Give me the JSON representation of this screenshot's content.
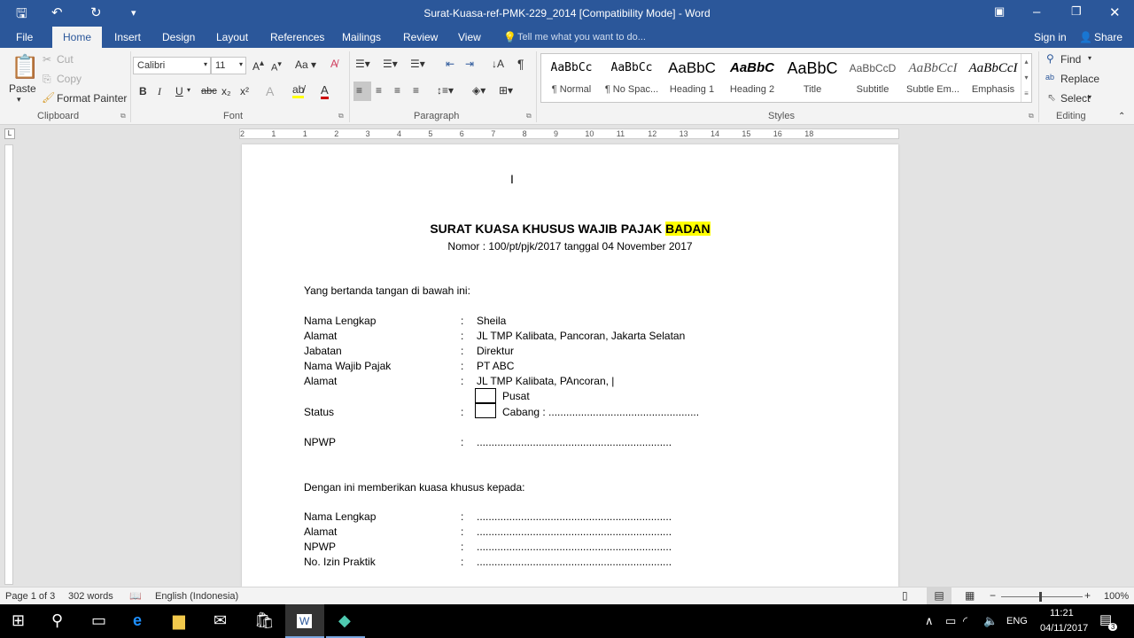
{
  "window": {
    "title": "Surat-Kuasa-ref-PMK-229_2014 [Compatibility Mode] - Word",
    "accent": "#2b579a"
  },
  "menu": {
    "tabs": [
      "File",
      "Home",
      "Insert",
      "Design",
      "Layout",
      "References",
      "Mailings",
      "Review",
      "View"
    ],
    "active": "Home",
    "tell_me": "Tell me what you want to do...",
    "sign_in": "Sign in",
    "share": "Share"
  },
  "ribbon": {
    "clipboard": {
      "label": "Clipboard",
      "paste": "Paste",
      "cut": "Cut",
      "copy": "Copy",
      "format_painter": "Format Painter"
    },
    "font": {
      "label": "Font",
      "name": "Calibri",
      "size": "11",
      "bold": "B",
      "italic": "I",
      "underline": "U",
      "strike": "abc",
      "sub": "x₂",
      "sup": "x²",
      "case": "Aa"
    },
    "paragraph": {
      "label": "Paragraph"
    },
    "styles": {
      "label": "Styles",
      "items": [
        {
          "preview": "AaBbCc",
          "name": "¶ Normal"
        },
        {
          "preview": "AaBbCc",
          "name": "¶ No Spac..."
        },
        {
          "preview": "AaBbC",
          "name": "Heading 1"
        },
        {
          "preview": "AaBbC",
          "name": "Heading 2"
        },
        {
          "preview": "AaBbC",
          "name": "Title"
        },
        {
          "preview": "AaBbCcD",
          "name": "Subtitle"
        },
        {
          "preview": "AaBbCcI",
          "name": "Subtle Em..."
        },
        {
          "preview": "AaBbCcI",
          "name": "Emphasis"
        }
      ]
    },
    "editing": {
      "label": "Editing",
      "find": "Find",
      "replace": "Replace",
      "select": "Select"
    }
  },
  "ruler": {
    "ticks": [
      "2",
      "1",
      "1",
      "2",
      "3",
      "4",
      "5",
      "6",
      "7",
      "8",
      "9",
      "10",
      "11",
      "12",
      "13",
      "14",
      "15",
      "16",
      "18"
    ]
  },
  "document": {
    "title": "SURAT KUASA KHUSUS WAJIB PAJAK ",
    "title_highlight": "BADAN",
    "nomor": "Nomor : 100/pt/pjk/2017 tanggal 04 November 2017",
    "intro": "Yang bertanda tangan di bawah ini:",
    "fields1": [
      {
        "label": "Nama Lengkap",
        "value": "Sheila"
      },
      {
        "label": "Alamat",
        "value": "JL TMP Kalibata, Pancoran, Jakarta Selatan"
      },
      {
        "label": "Jabatan",
        "value": "Direktur"
      },
      {
        "label": "Nama Wajib Pajak",
        "value": "PT ABC"
      },
      {
        "label": "Alamat",
        "value": "JL TMP Kalibata, PAncoran, |"
      }
    ],
    "status_label": "Status",
    "status_pusat": "Pusat",
    "status_cabang": "Cabang : ...................................................",
    "npwp_label": "NPWP",
    "npwp_value": "..................................................................",
    "intro2": "Dengan ini memberikan kuasa khusus kepada:",
    "fields2": [
      {
        "label": "Nama Lengkap",
        "value": ".................................................................."
      },
      {
        "label": "Alamat",
        "value": ".................................................................."
      },
      {
        "label": "NPWP",
        "value": ".................................................................."
      },
      {
        "label": "No. Izin Praktik",
        "value": ".................................................................."
      }
    ],
    "colon": ":"
  },
  "statusbar": {
    "page": "Page 1 of 3",
    "words": "302 words",
    "language": "English (Indonesia)",
    "zoom": "100%",
    "zoom_level": 100
  },
  "taskbar": {
    "time": "11:21",
    "date": "04/11/2017",
    "lang": "ENG",
    "notifications": "3"
  }
}
